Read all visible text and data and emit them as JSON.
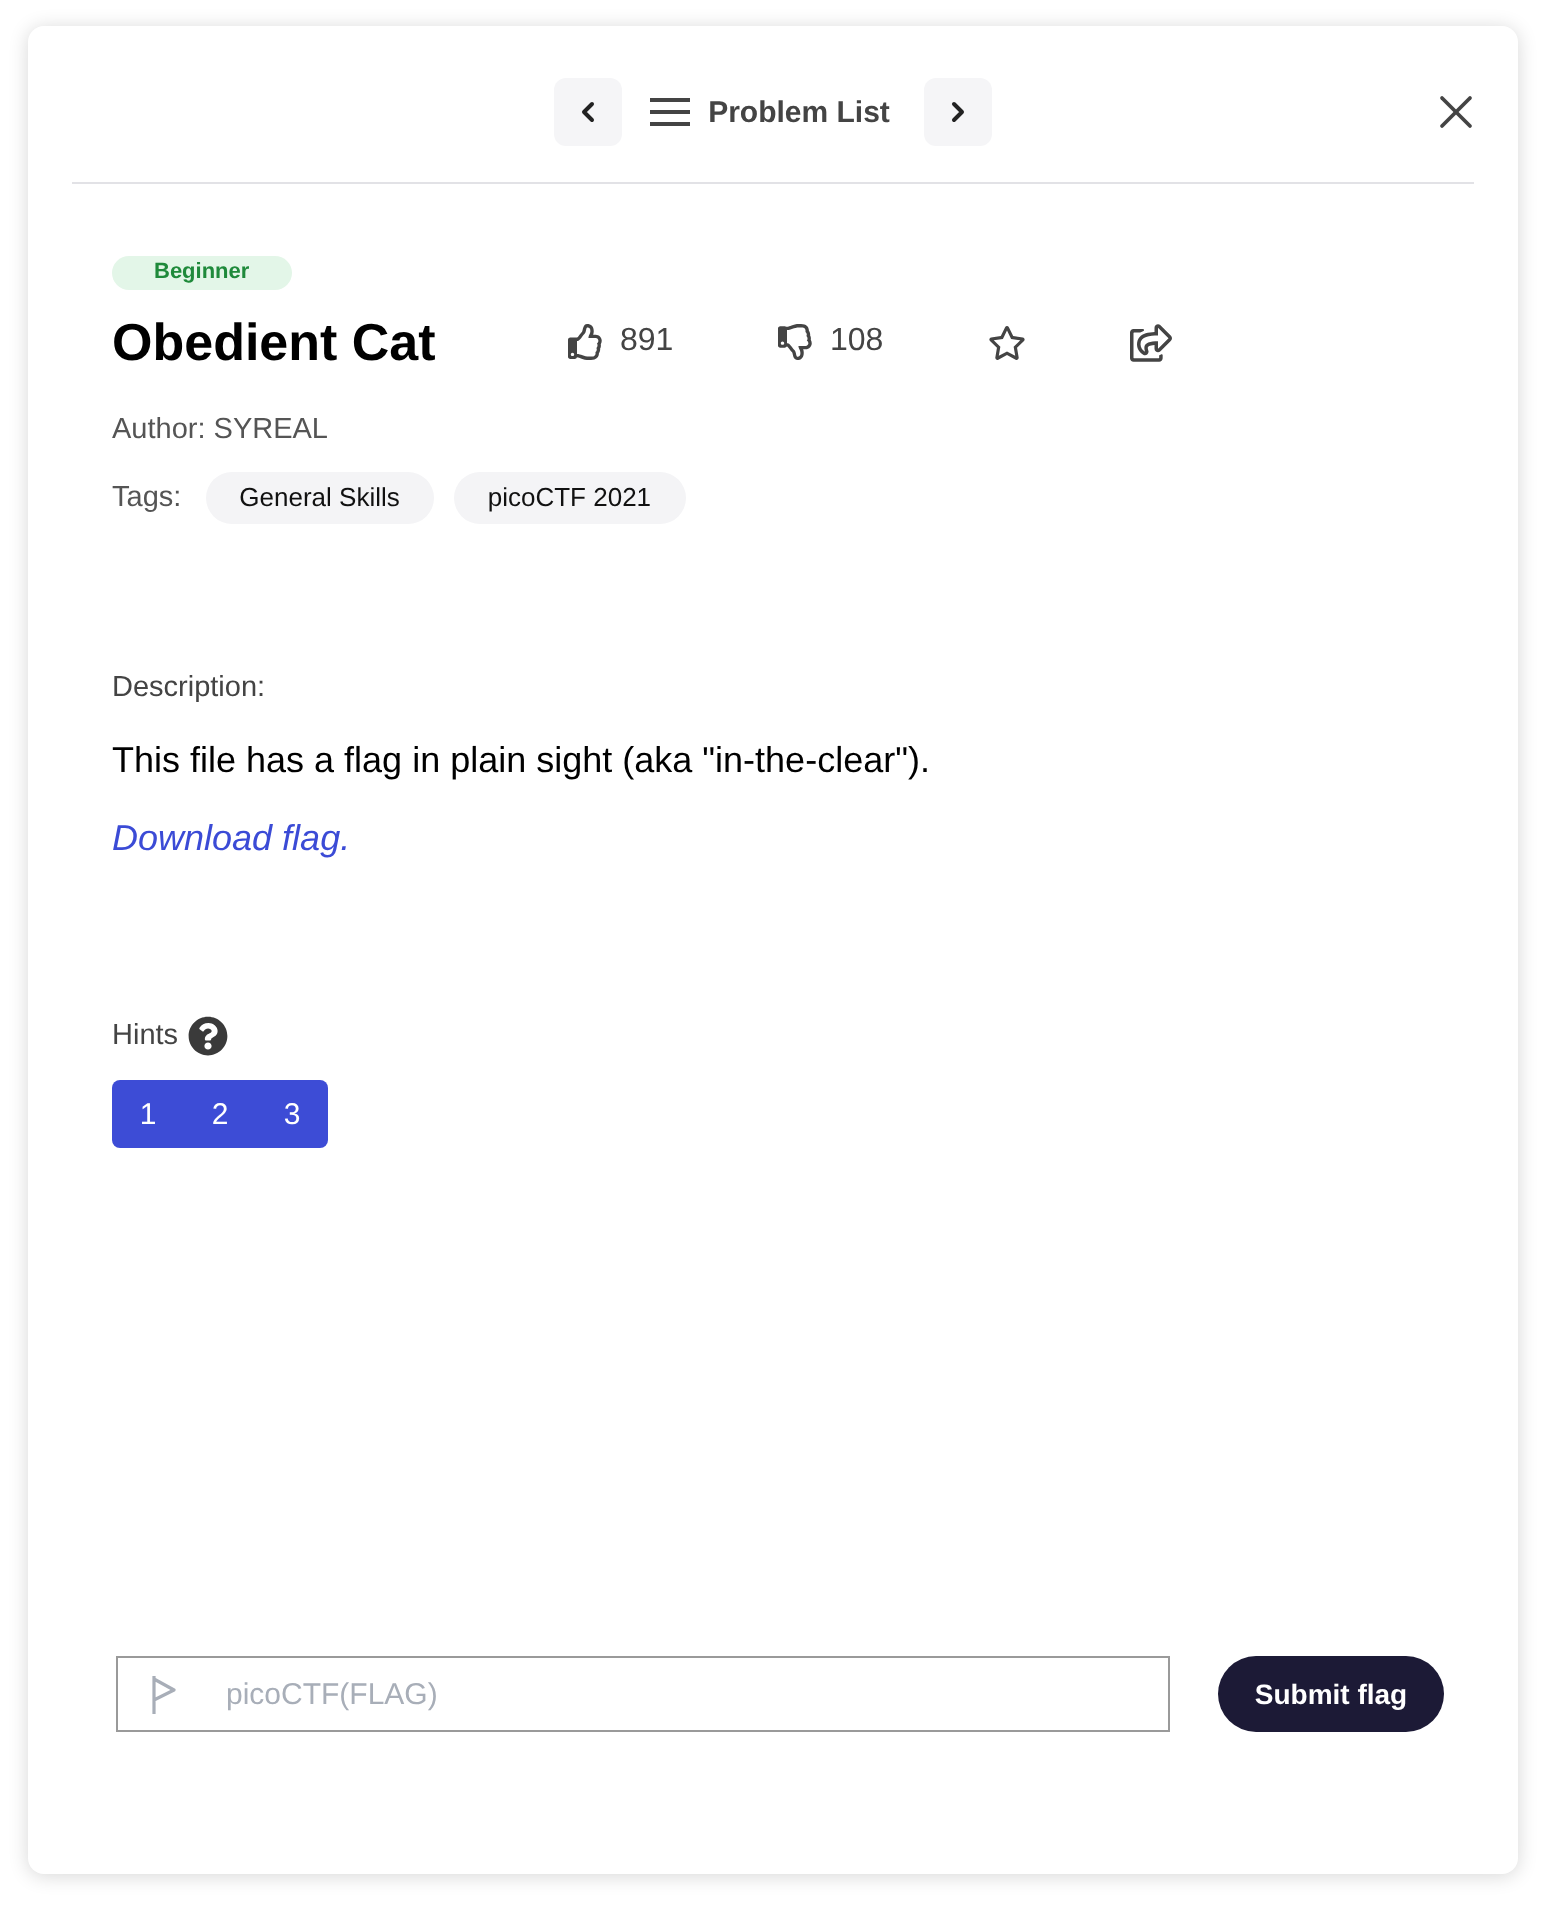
{
  "nav": {
    "label": "Problem List"
  },
  "problem": {
    "difficulty": "Beginner",
    "title": "Obedient Cat",
    "likes": "891",
    "dislikes": "108",
    "author": "Author: SYREAL",
    "tags_label": "Tags:",
    "tags": [
      "General Skills",
      "picoCTF 2021"
    ]
  },
  "description": {
    "label": "Description:",
    "text": "This file has a flag in plain sight (aka \"in-the-clear\").",
    "link": "Download flag."
  },
  "hints": {
    "label": "Hints",
    "items": [
      "1",
      "2",
      "3"
    ]
  },
  "flag_form": {
    "placeholder": "picoCTF(FLAG)",
    "submit": "Submit flag"
  }
}
